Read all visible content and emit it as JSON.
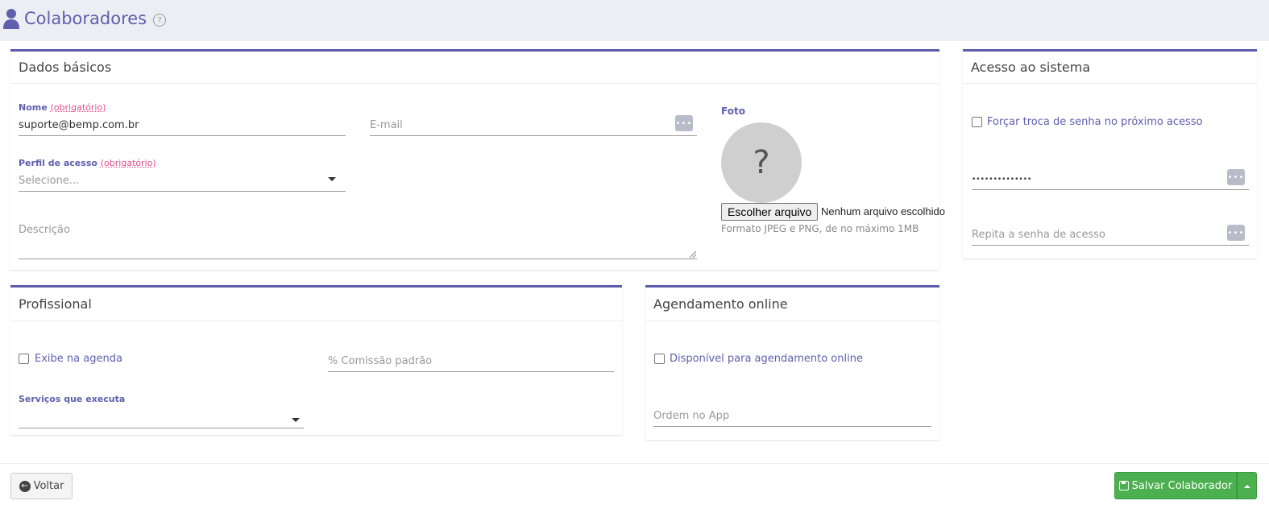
{
  "page": {
    "title": "Colaboradores",
    "help_glyph": "?"
  },
  "basic": {
    "header": "Dados básicos",
    "name_label": "Nome",
    "required_tag": "(obrigatório)",
    "name_value": "suporte@bemp.com.br",
    "email_placeholder": "E-mail",
    "profile_label": "Perfil de acesso",
    "profile_placeholder": "Selecione...",
    "description_placeholder": "Descrição",
    "photo_label": "Foto",
    "photo_placeholder_glyph": "?",
    "file_button": "Escolher arquivo",
    "file_status": "Nenhum arquivo escolhido",
    "file_hint": "Formato JPEG e PNG, de no máximo 1MB"
  },
  "access": {
    "header": "Acesso ao sistema",
    "force_change_label": "Forçar troca de senha no próximo acesso",
    "password_value": "••••••••••••••",
    "repeat_placeholder": "Repita a senha de acesso"
  },
  "professional": {
    "header": "Profissional",
    "show_agenda_label": "Exibe na agenda",
    "commission_placeholder": "% Comissão padrão",
    "services_label": "Serviços que executa"
  },
  "online": {
    "header": "Agendamento online",
    "available_label": "Disponível para agendamento online",
    "order_placeholder": "Ordem no App"
  },
  "footer": {
    "back_label": "Voltar",
    "save_label": "Salvar Colaborador"
  },
  "colors": {
    "accent": "#5c5cae",
    "required": "#e0508d",
    "success": "#4caf50",
    "topbar": "#eceef3"
  },
  "icons": {
    "title": "user-icon",
    "help": "question-circle-icon",
    "password_toggle": "dots-icon",
    "back": "arrow-left-circle-icon",
    "save": "floppy-disk-icon"
  }
}
